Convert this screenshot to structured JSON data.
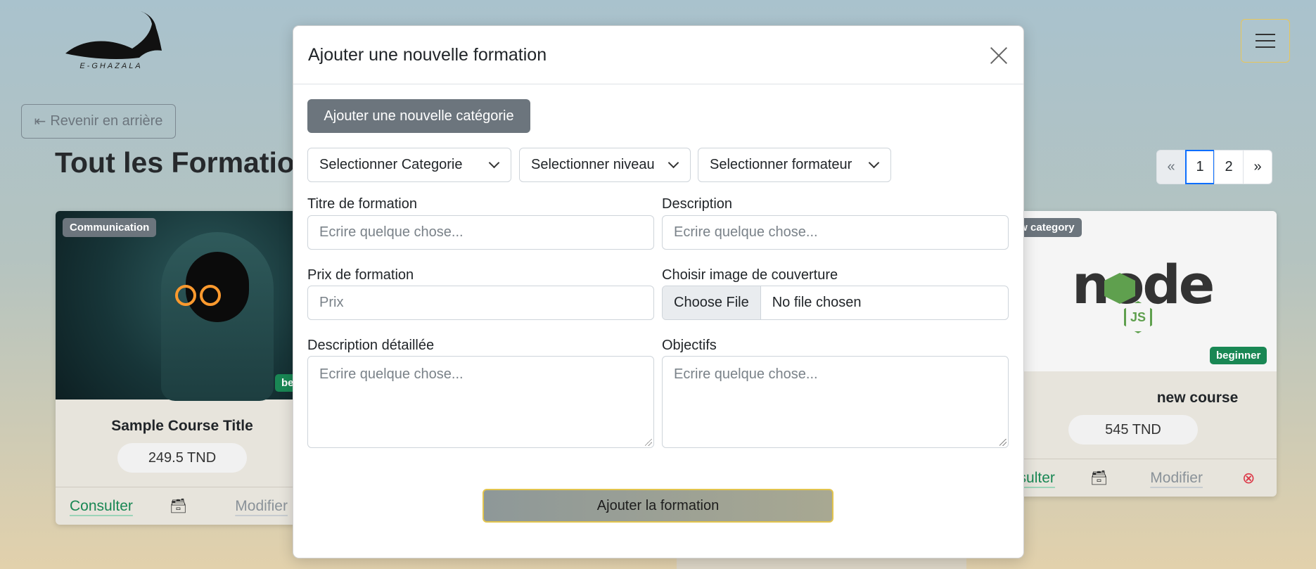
{
  "brand": {
    "logo_text": "E-GHAZALA"
  },
  "header": {
    "menu_icon": "hamburger-icon"
  },
  "nav": {
    "back_label": "Revenir en arrière",
    "back_icon": "arrow-left-bar-icon"
  },
  "page": {
    "title": "Tout les Formations"
  },
  "pagination": {
    "prev": "«",
    "pages": [
      "1",
      "2"
    ],
    "next": "»",
    "active_page": "1"
  },
  "courses": [
    {
      "category": "Communication",
      "level": "beginner",
      "title": "Sample Course Title",
      "price": "249.5 TND",
      "actions": {
        "view": "Consulter",
        "edit": "Modifier",
        "archive_icon": "archive-icon"
      }
    },
    {
      "category": "New category",
      "level": "beginner",
      "title": "new course",
      "price": "545 TND",
      "image_text": "node",
      "image_badge": "JS",
      "actions": {
        "view": "Consulter",
        "edit": "Modifier",
        "archive_icon": "archive-icon",
        "delete_icon": "circle-x-icon"
      }
    }
  ],
  "modal": {
    "title": "Ajouter une nouvelle formation",
    "close_icon": "close-icon",
    "add_category_label": "Ajouter une nouvelle catégorie",
    "selects": {
      "category": "Selectionner Categorie",
      "level": "Selectionner niveau",
      "trainer": "Selectionner formateur"
    },
    "fields": {
      "title_label": "Titre de formation",
      "title_placeholder": "Ecrire quelque chose...",
      "description_label": "Description",
      "description_placeholder": "Ecrire quelque chose...",
      "price_label": "Prix de formation",
      "price_placeholder": "Prix",
      "cover_label": "Choisir image de couverture",
      "cover_button": "Choose File",
      "cover_status": "No file chosen",
      "detailed_label": "Description détaillée",
      "detailed_placeholder": "Ecrire quelque chose...",
      "objectives_label": "Objectifs",
      "objectives_placeholder": "Ecrire quelque chose..."
    },
    "submit_label": "Ajouter la formation"
  },
  "colors": {
    "secondary": "#6c757d",
    "success": "#198754",
    "primary": "#0d6efd",
    "accent_border": "#e2c44e",
    "danger": "#dc3545"
  }
}
